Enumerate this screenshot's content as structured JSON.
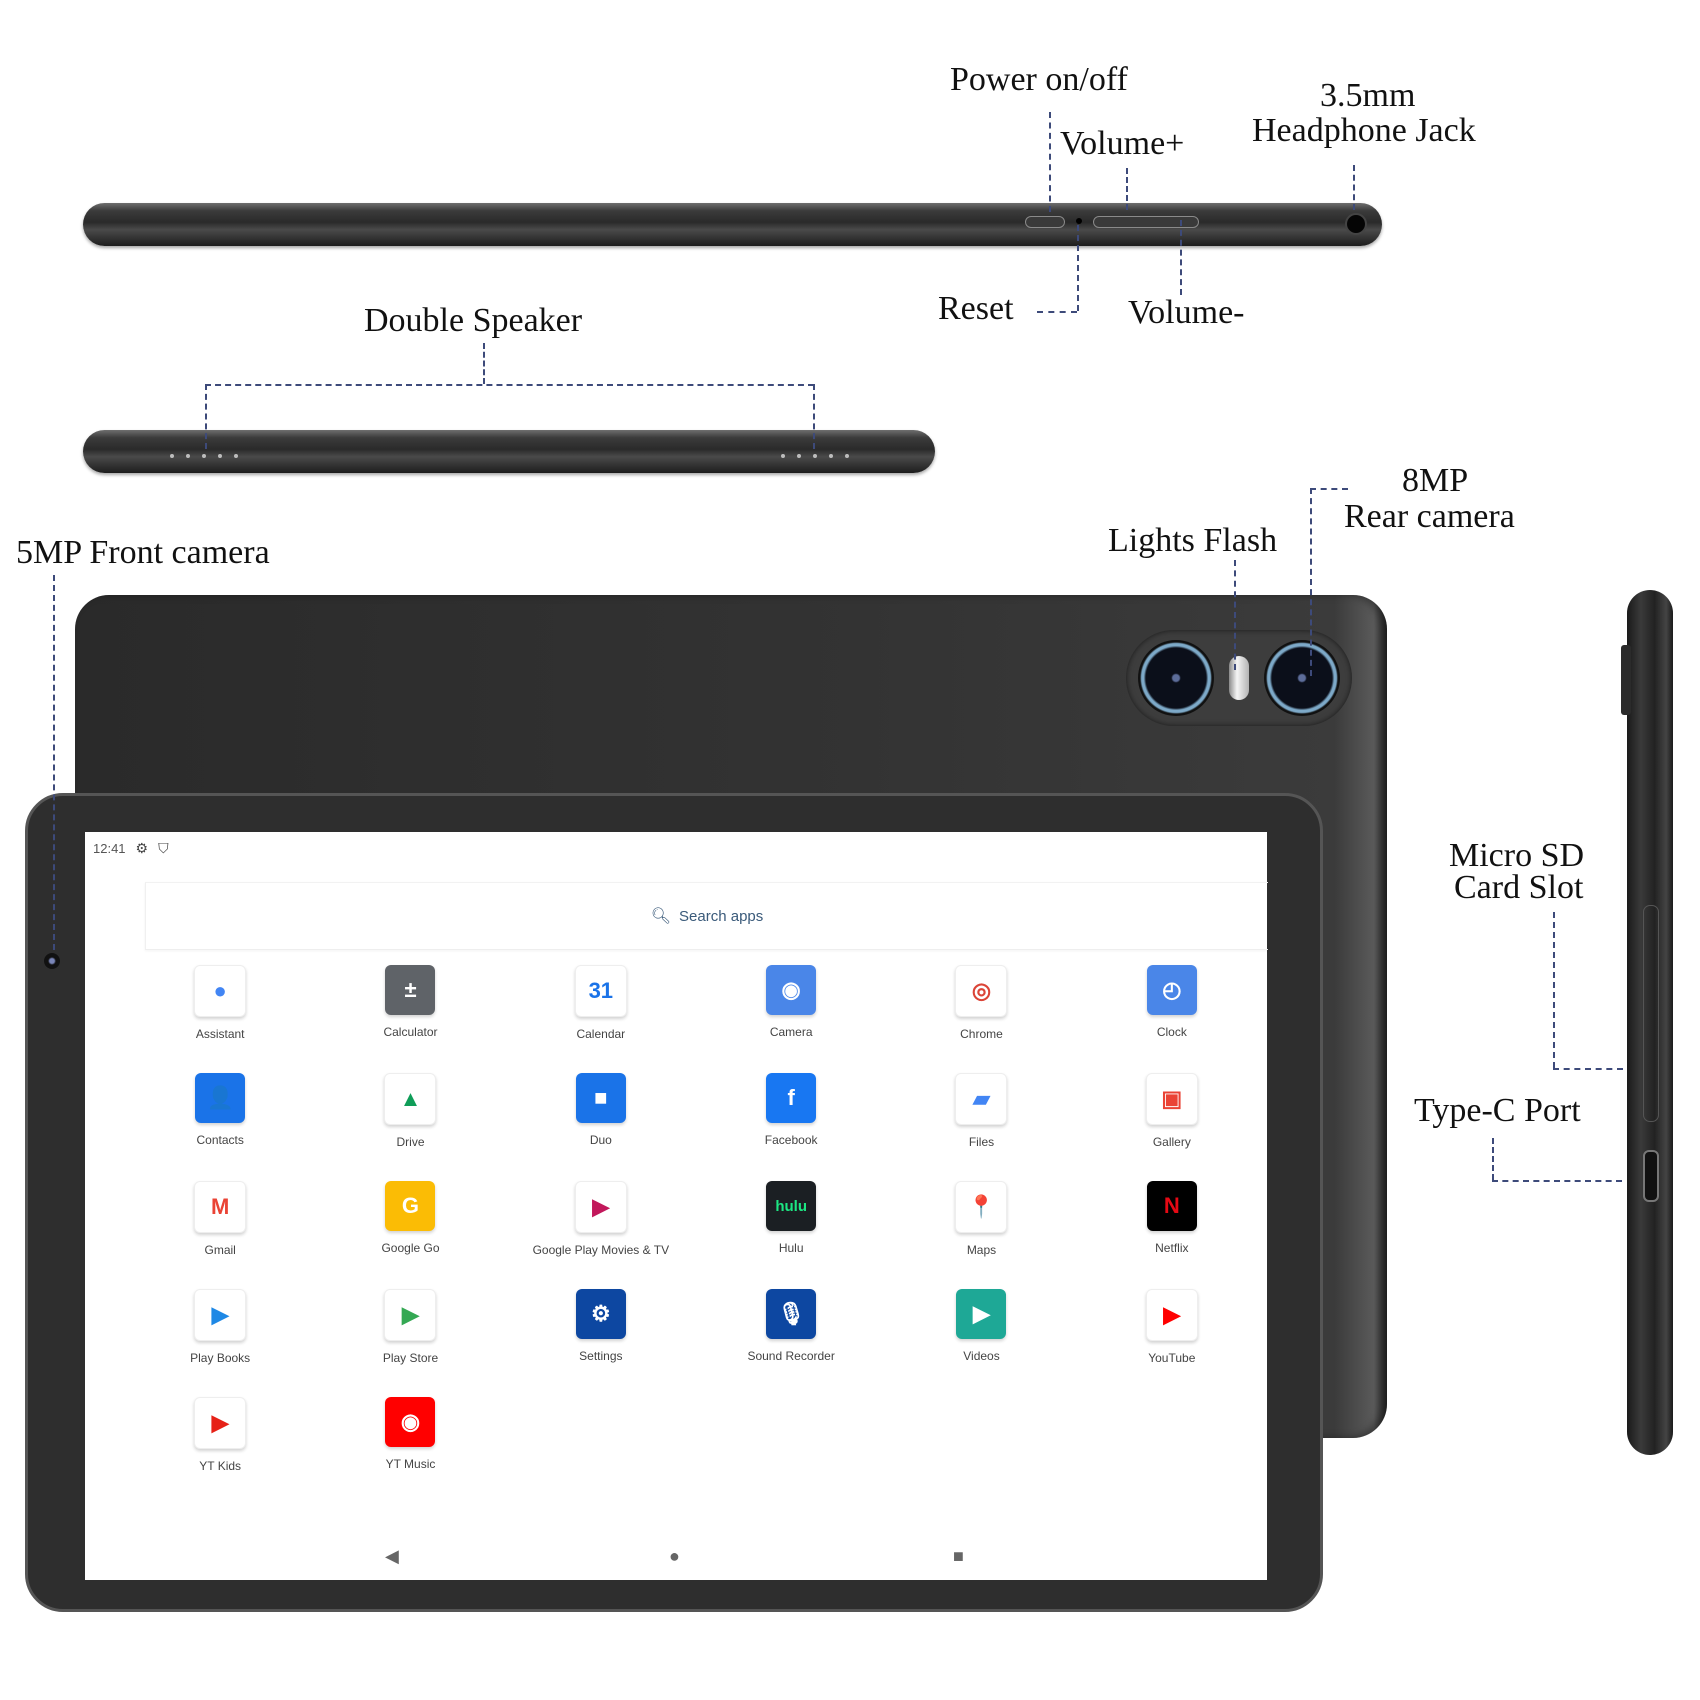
{
  "callouts": {
    "power": "Power on/off",
    "volume_plus": "Volume+",
    "headphone_line1": "3.5mm",
    "headphone_line2": "Headphone Jack",
    "reset": "Reset",
    "volume_minus": "Volume-",
    "double_speaker": "Double Speaker",
    "front_camera": "5MP Front camera",
    "lights_flash": "Lights Flash",
    "rear_camera_line1": "8MP",
    "rear_camera_line2": "Rear camera",
    "micro_sd_line1": "Micro SD",
    "micro_sd_line2": "Card Slot",
    "type_c": "Type-C Port"
  },
  "screen": {
    "status_bar": {
      "time": "12:41",
      "icons": [
        "gear-icon",
        "shield-icon"
      ]
    },
    "search": {
      "icon": "search-icon",
      "placeholder": "Search apps"
    },
    "apps": [
      {
        "label": "Assistant",
        "icon": "assistant-icon",
        "bg": "#ffffff",
        "fg": "#4285f4",
        "glyph": "●"
      },
      {
        "label": "Calculator",
        "icon": "calculator-icon",
        "bg": "#5f6368",
        "fg": "#ffffff",
        "glyph": "±"
      },
      {
        "label": "Calendar",
        "icon": "calendar-icon",
        "bg": "#ffffff",
        "fg": "#1a73e8",
        "glyph": "31"
      },
      {
        "label": "Camera",
        "icon": "camera-icon",
        "bg": "#4a86e8",
        "fg": "#ffffff",
        "glyph": "◉"
      },
      {
        "label": "Chrome",
        "icon": "chrome-icon",
        "bg": "#ffffff",
        "fg": "#db4437",
        "glyph": "◎"
      },
      {
        "label": "Clock",
        "icon": "clock-icon",
        "bg": "#4a86e8",
        "fg": "#ffffff",
        "glyph": "◴"
      },
      {
        "label": "Contacts",
        "icon": "contacts-icon",
        "bg": "#1a73e8",
        "fg": "#ffffff",
        "glyph": "👤"
      },
      {
        "label": "Drive",
        "icon": "drive-icon",
        "bg": "#ffffff",
        "fg": "#0f9d58",
        "glyph": "▲"
      },
      {
        "label": "Duo",
        "icon": "duo-icon",
        "bg": "#1a73e8",
        "fg": "#ffffff",
        "glyph": "■"
      },
      {
        "label": "Facebook",
        "icon": "facebook-icon",
        "bg": "#1877f2",
        "fg": "#ffffff",
        "glyph": "f"
      },
      {
        "label": "Files",
        "icon": "files-icon",
        "bg": "#ffffff",
        "fg": "#4285f4",
        "glyph": "▰"
      },
      {
        "label": "Gallery",
        "icon": "gallery-icon",
        "bg": "#ffffff",
        "fg": "#ea4335",
        "glyph": "▣"
      },
      {
        "label": "Gmail",
        "icon": "gmail-icon",
        "bg": "#ffffff",
        "fg": "#ea4335",
        "glyph": "M"
      },
      {
        "label": "Google Go",
        "icon": "google-go-icon",
        "bg": "#fbbc05",
        "fg": "#ffffff",
        "glyph": "G"
      },
      {
        "label": "Google Play Movies & TV",
        "icon": "play-movies-icon",
        "bg": "#ffffff",
        "fg": "#c2185b",
        "glyph": "▶"
      },
      {
        "label": "Hulu",
        "icon": "hulu-icon",
        "bg": "#1b1f23",
        "fg": "#1ce783",
        "glyph": "hulu"
      },
      {
        "label": "Maps",
        "icon": "maps-icon",
        "bg": "#ffffff",
        "fg": "#34a853",
        "glyph": "📍"
      },
      {
        "label": "Netflix",
        "icon": "netflix-icon",
        "bg": "#000000",
        "fg": "#e50914",
        "glyph": "N"
      },
      {
        "label": "Play Books",
        "icon": "play-books-icon",
        "bg": "#ffffff",
        "fg": "#1e88e5",
        "glyph": "▶"
      },
      {
        "label": "Play Store",
        "icon": "play-store-icon",
        "bg": "#ffffff",
        "fg": "#34a853",
        "glyph": "▶"
      },
      {
        "label": "Settings",
        "icon": "settings-icon",
        "bg": "#0d47a1",
        "fg": "#ffffff",
        "glyph": "⚙"
      },
      {
        "label": "Sound Recorder",
        "icon": "microphone-icon",
        "bg": "#0d47a1",
        "fg": "#ffffff",
        "glyph": "🎙"
      },
      {
        "label": "Videos",
        "icon": "videos-icon",
        "bg": "#1ea896",
        "fg": "#ffffff",
        "glyph": "▶"
      },
      {
        "label": "YouTube",
        "icon": "youtube-icon",
        "bg": "#ffffff",
        "fg": "#ff0000",
        "glyph": "▶"
      },
      {
        "label": "YT Kids",
        "icon": "yt-kids-icon",
        "bg": "#ffffff",
        "fg": "#e62117",
        "glyph": "▶"
      },
      {
        "label": "YT Music",
        "icon": "yt-music-icon",
        "bg": "#ff0000",
        "fg": "#ffffff",
        "glyph": "◉"
      }
    ],
    "nav": {
      "back_icon": "◀",
      "home_icon": "●",
      "recents_icon": "■"
    }
  }
}
